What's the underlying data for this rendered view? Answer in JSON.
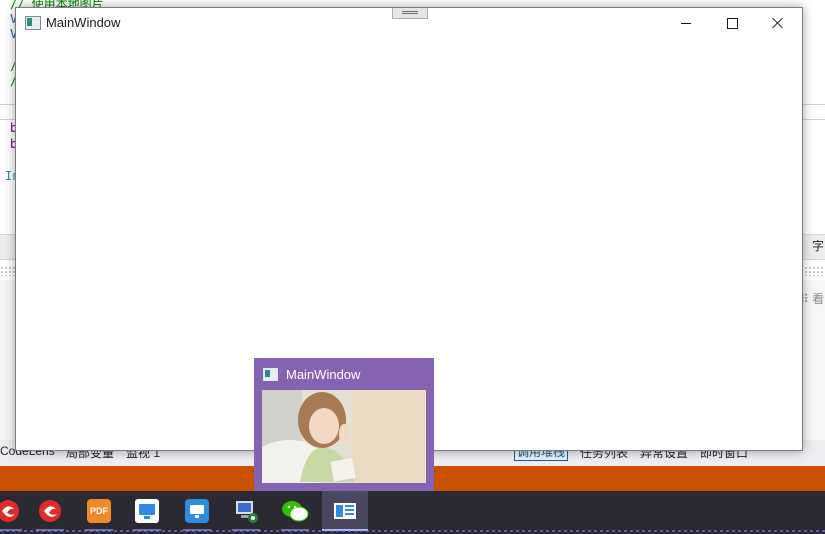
{
  "background_ide": {
    "code_lines": [
      {
        "text": "// 使用本地图片",
        "color": "green"
      },
      {
        "text": "V",
        "color": "blue"
      },
      {
        "text": "V",
        "color": "blue"
      },
      {
        "text": "/",
        "color": "green"
      },
      {
        "text": "/",
        "color": "green"
      },
      {
        "text": "b",
        "color": "purple"
      },
      {
        "text": "b",
        "color": "purple"
      },
      {
        "text": "In",
        "color": "teal"
      }
    ],
    "right_char": "字",
    "bottom_tabs": [
      "CodeLens",
      "局部变量",
      "监视 1",
      "调用堆栈",
      "任务列表",
      "异常设置",
      "即时窗口"
    ],
    "active_tab": "调用堆栈"
  },
  "window": {
    "title": "MainWindow",
    "icon": "app-window-icon",
    "controls": [
      "minimize",
      "maximize",
      "close"
    ]
  },
  "preview": {
    "title": "MainWindow",
    "thumbnail": "photo-of-girl"
  },
  "taskbar": {
    "apps": [
      {
        "name": "red-app-1",
        "color": "#e02b2b"
      },
      {
        "name": "red-app-2",
        "color": "#e02b2b"
      },
      {
        "name": "pdf-app",
        "color": "#f08a24",
        "label": "PDF"
      },
      {
        "name": "remote-desktop-app",
        "color": "#2f8be0"
      },
      {
        "name": "screen-cast-app",
        "color": "#2f8be0"
      },
      {
        "name": "network-computer-app",
        "color": "#4a7fd0"
      },
      {
        "name": "wechat-app",
        "color": "#2dc100"
      },
      {
        "name": "mainwindow-app",
        "color": "#2f8be0"
      }
    ]
  },
  "colors": {
    "preview_bg": "#8463b0",
    "orange_bar": "#ca5100",
    "taskbar_bg": "#2b2a33"
  }
}
